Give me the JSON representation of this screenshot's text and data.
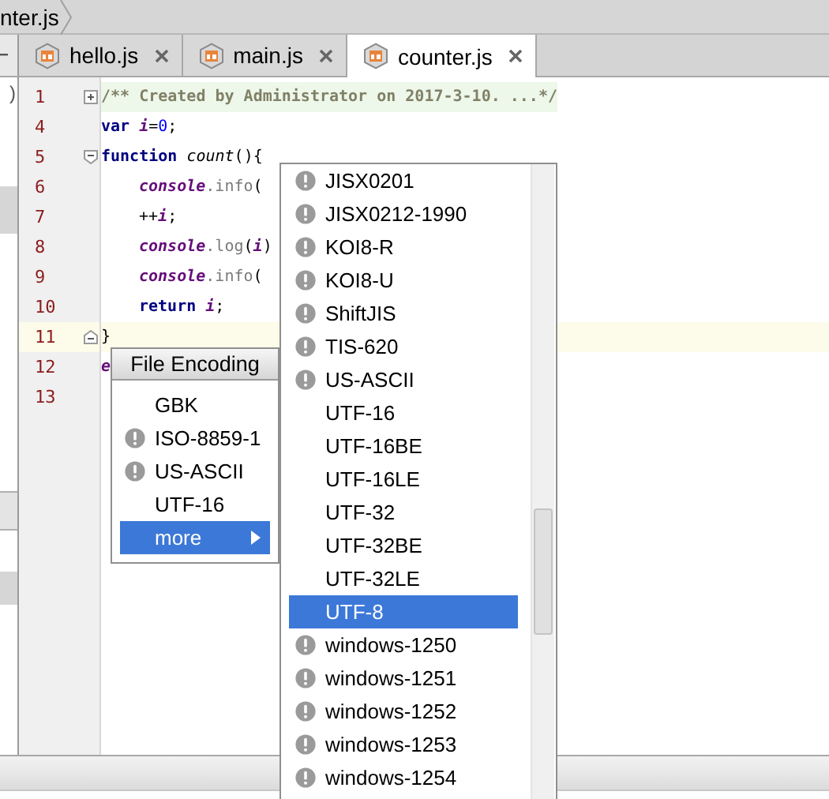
{
  "breadcrumb": {
    "label": "nter.js"
  },
  "left_panel": {
    "fragment": ")"
  },
  "tabs": [
    {
      "label": "hello.js",
      "selected": false
    },
    {
      "label": "main.js",
      "selected": false
    },
    {
      "label": "counter.js",
      "selected": true
    }
  ],
  "code_lines": [
    {
      "number": "1",
      "kind": "folded",
      "current": false,
      "tokens": [
        {
          "kind": "comment",
          "text": "/** Created by Administrator on 2017-3-10. ...*/"
        }
      ]
    },
    {
      "number": "4",
      "kind": "plain",
      "current": false,
      "tokens": [
        {
          "kind": "keyword",
          "text": "var"
        },
        {
          "kind": "var",
          "text": " i"
        },
        {
          "kind": "plain",
          "text": "="
        },
        {
          "kind": "number",
          "text": "0"
        },
        {
          "kind": "plain",
          "text": ";"
        }
      ]
    },
    {
      "number": "5",
      "kind": "block-start",
      "current": false,
      "tokens": [
        {
          "kind": "keyword",
          "text": "function"
        },
        {
          "kind": "func",
          "text": " count"
        },
        {
          "kind": "plain",
          "text": "(){"
        }
      ]
    },
    {
      "number": "6",
      "kind": "plain",
      "indented": true,
      "current": false,
      "tokens": [
        {
          "kind": "global",
          "text": "console"
        },
        {
          "kind": "method",
          "text": ".info"
        },
        {
          "kind": "plain",
          "text": "("
        }
      ]
    },
    {
      "number": "7",
      "kind": "plain",
      "indented": true,
      "current": false,
      "tokens": [
        {
          "kind": "plain",
          "text": "++"
        },
        {
          "kind": "var",
          "text": "i"
        },
        {
          "kind": "plain",
          "text": ";"
        }
      ]
    },
    {
      "number": "8",
      "kind": "plain",
      "indented": true,
      "current": false,
      "tokens": [
        {
          "kind": "global",
          "text": "console"
        },
        {
          "kind": "method",
          "text": ".log"
        },
        {
          "kind": "plain",
          "text": "("
        },
        {
          "kind": "var",
          "text": "i"
        },
        {
          "kind": "plain",
          "text": ")"
        }
      ]
    },
    {
      "number": "9",
      "kind": "plain",
      "indented": true,
      "current": false,
      "tokens": [
        {
          "kind": "global",
          "text": "console"
        },
        {
          "kind": "method",
          "text": ".info"
        },
        {
          "kind": "plain",
          "text": "("
        }
      ]
    },
    {
      "number": "10",
      "kind": "plain",
      "indented": true,
      "current": false,
      "tokens": [
        {
          "kind": "keyword",
          "text": "return"
        },
        {
          "kind": "var",
          "text": " i"
        },
        {
          "kind": "plain",
          "text": ";"
        }
      ]
    },
    {
      "number": "11",
      "kind": "block-end",
      "current": true,
      "tokens": [
        {
          "kind": "plain",
          "text": "}"
        }
      ]
    },
    {
      "number": "12",
      "kind": "plain",
      "current": false,
      "tokens": [
        {
          "kind": "global",
          "text": "e"
        }
      ]
    },
    {
      "number": "13",
      "kind": "plain",
      "current": false
    }
  ],
  "encoding_menu": {
    "title": "File Encoding",
    "items": [
      {
        "label": "GBK",
        "warning": false,
        "selected": false
      },
      {
        "label": "ISO-8859-1",
        "warning": true,
        "selected": false
      },
      {
        "label": "US-ASCII",
        "warning": true,
        "selected": false
      },
      {
        "label": "UTF-16",
        "warning": false,
        "selected": false
      },
      {
        "label": "more",
        "warning": false,
        "selected": true,
        "submenu": true
      }
    ]
  },
  "more_menu": {
    "items": [
      {
        "label": "JISX0201",
        "warning": true,
        "selected": false
      },
      {
        "label": "JISX0212-1990",
        "warning": true,
        "selected": false
      },
      {
        "label": "KOI8-R",
        "warning": true,
        "selected": false
      },
      {
        "label": "KOI8-U",
        "warning": true,
        "selected": false
      },
      {
        "label": "ShiftJIS",
        "warning": true,
        "selected": false
      },
      {
        "label": "TIS-620",
        "warning": true,
        "selected": false
      },
      {
        "label": "US-ASCII",
        "warning": true,
        "selected": false
      },
      {
        "label": "UTF-16",
        "warning": false,
        "selected": false
      },
      {
        "label": "UTF-16BE",
        "warning": false,
        "selected": false
      },
      {
        "label": "UTF-16LE",
        "warning": false,
        "selected": false
      },
      {
        "label": "UTF-32",
        "warning": false,
        "selected": false
      },
      {
        "label": "UTF-32BE",
        "warning": false,
        "selected": false
      },
      {
        "label": "UTF-32LE",
        "warning": false,
        "selected": false
      },
      {
        "label": "UTF-8",
        "warning": false,
        "selected": true
      },
      {
        "label": "windows-1250",
        "warning": true,
        "selected": false
      },
      {
        "label": "windows-1251",
        "warning": true,
        "selected": false
      },
      {
        "label": "windows-1252",
        "warning": true,
        "selected": false
      },
      {
        "label": "windows-1253",
        "warning": true,
        "selected": false
      },
      {
        "label": "windows-1254",
        "warning": true,
        "selected": false
      }
    ]
  }
}
